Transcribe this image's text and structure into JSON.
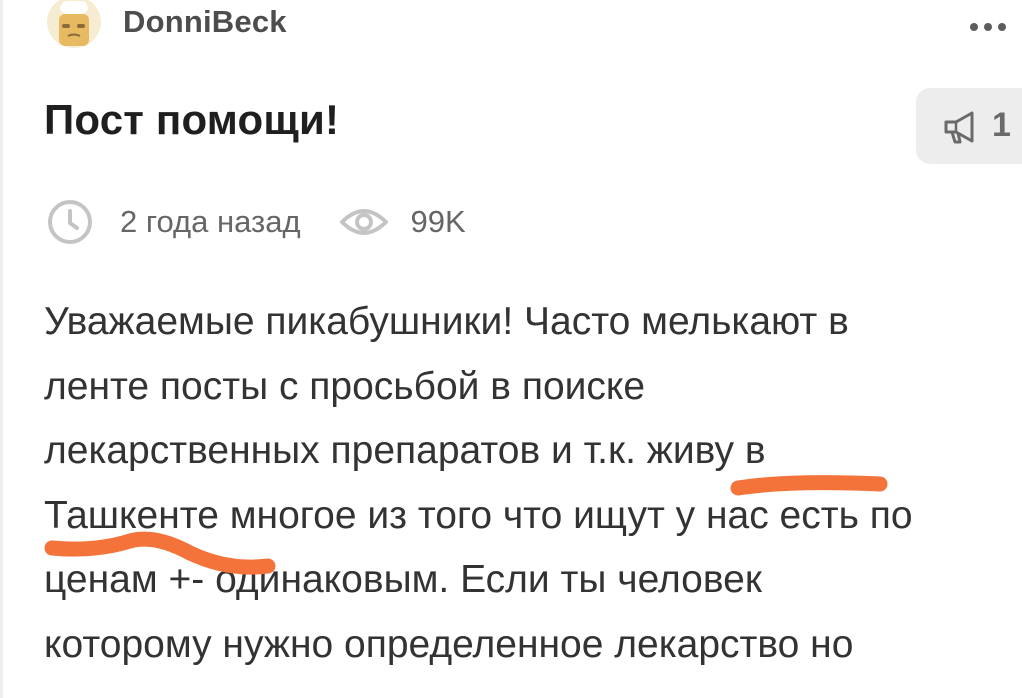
{
  "post": {
    "author": "DonniBeck",
    "title": "Пост помощи!",
    "community_count": "1",
    "time_ago": "2 года назад",
    "views": "99K",
    "body_lines": [
      "Уважаемые пикабушники! Часто мелькают в",
      "ленте посты с просьбой в поиске",
      "лекарственных препаратов и т.к. живу в",
      "Ташкенте многое из того что ищут у нас есть по",
      "ценам +- одинаковым. Если ты человек",
      "которому нужно определенное лекарство но"
    ]
  },
  "icons": {
    "avatar": "avatar-image",
    "more": "more-dots-icon",
    "community": "megaphone-icon",
    "time": "clock-icon",
    "views": "eye-icon"
  },
  "colors": {
    "highlight_marker": "#f4733a",
    "badge_bg": "#ededed",
    "meta_text": "#666666"
  }
}
